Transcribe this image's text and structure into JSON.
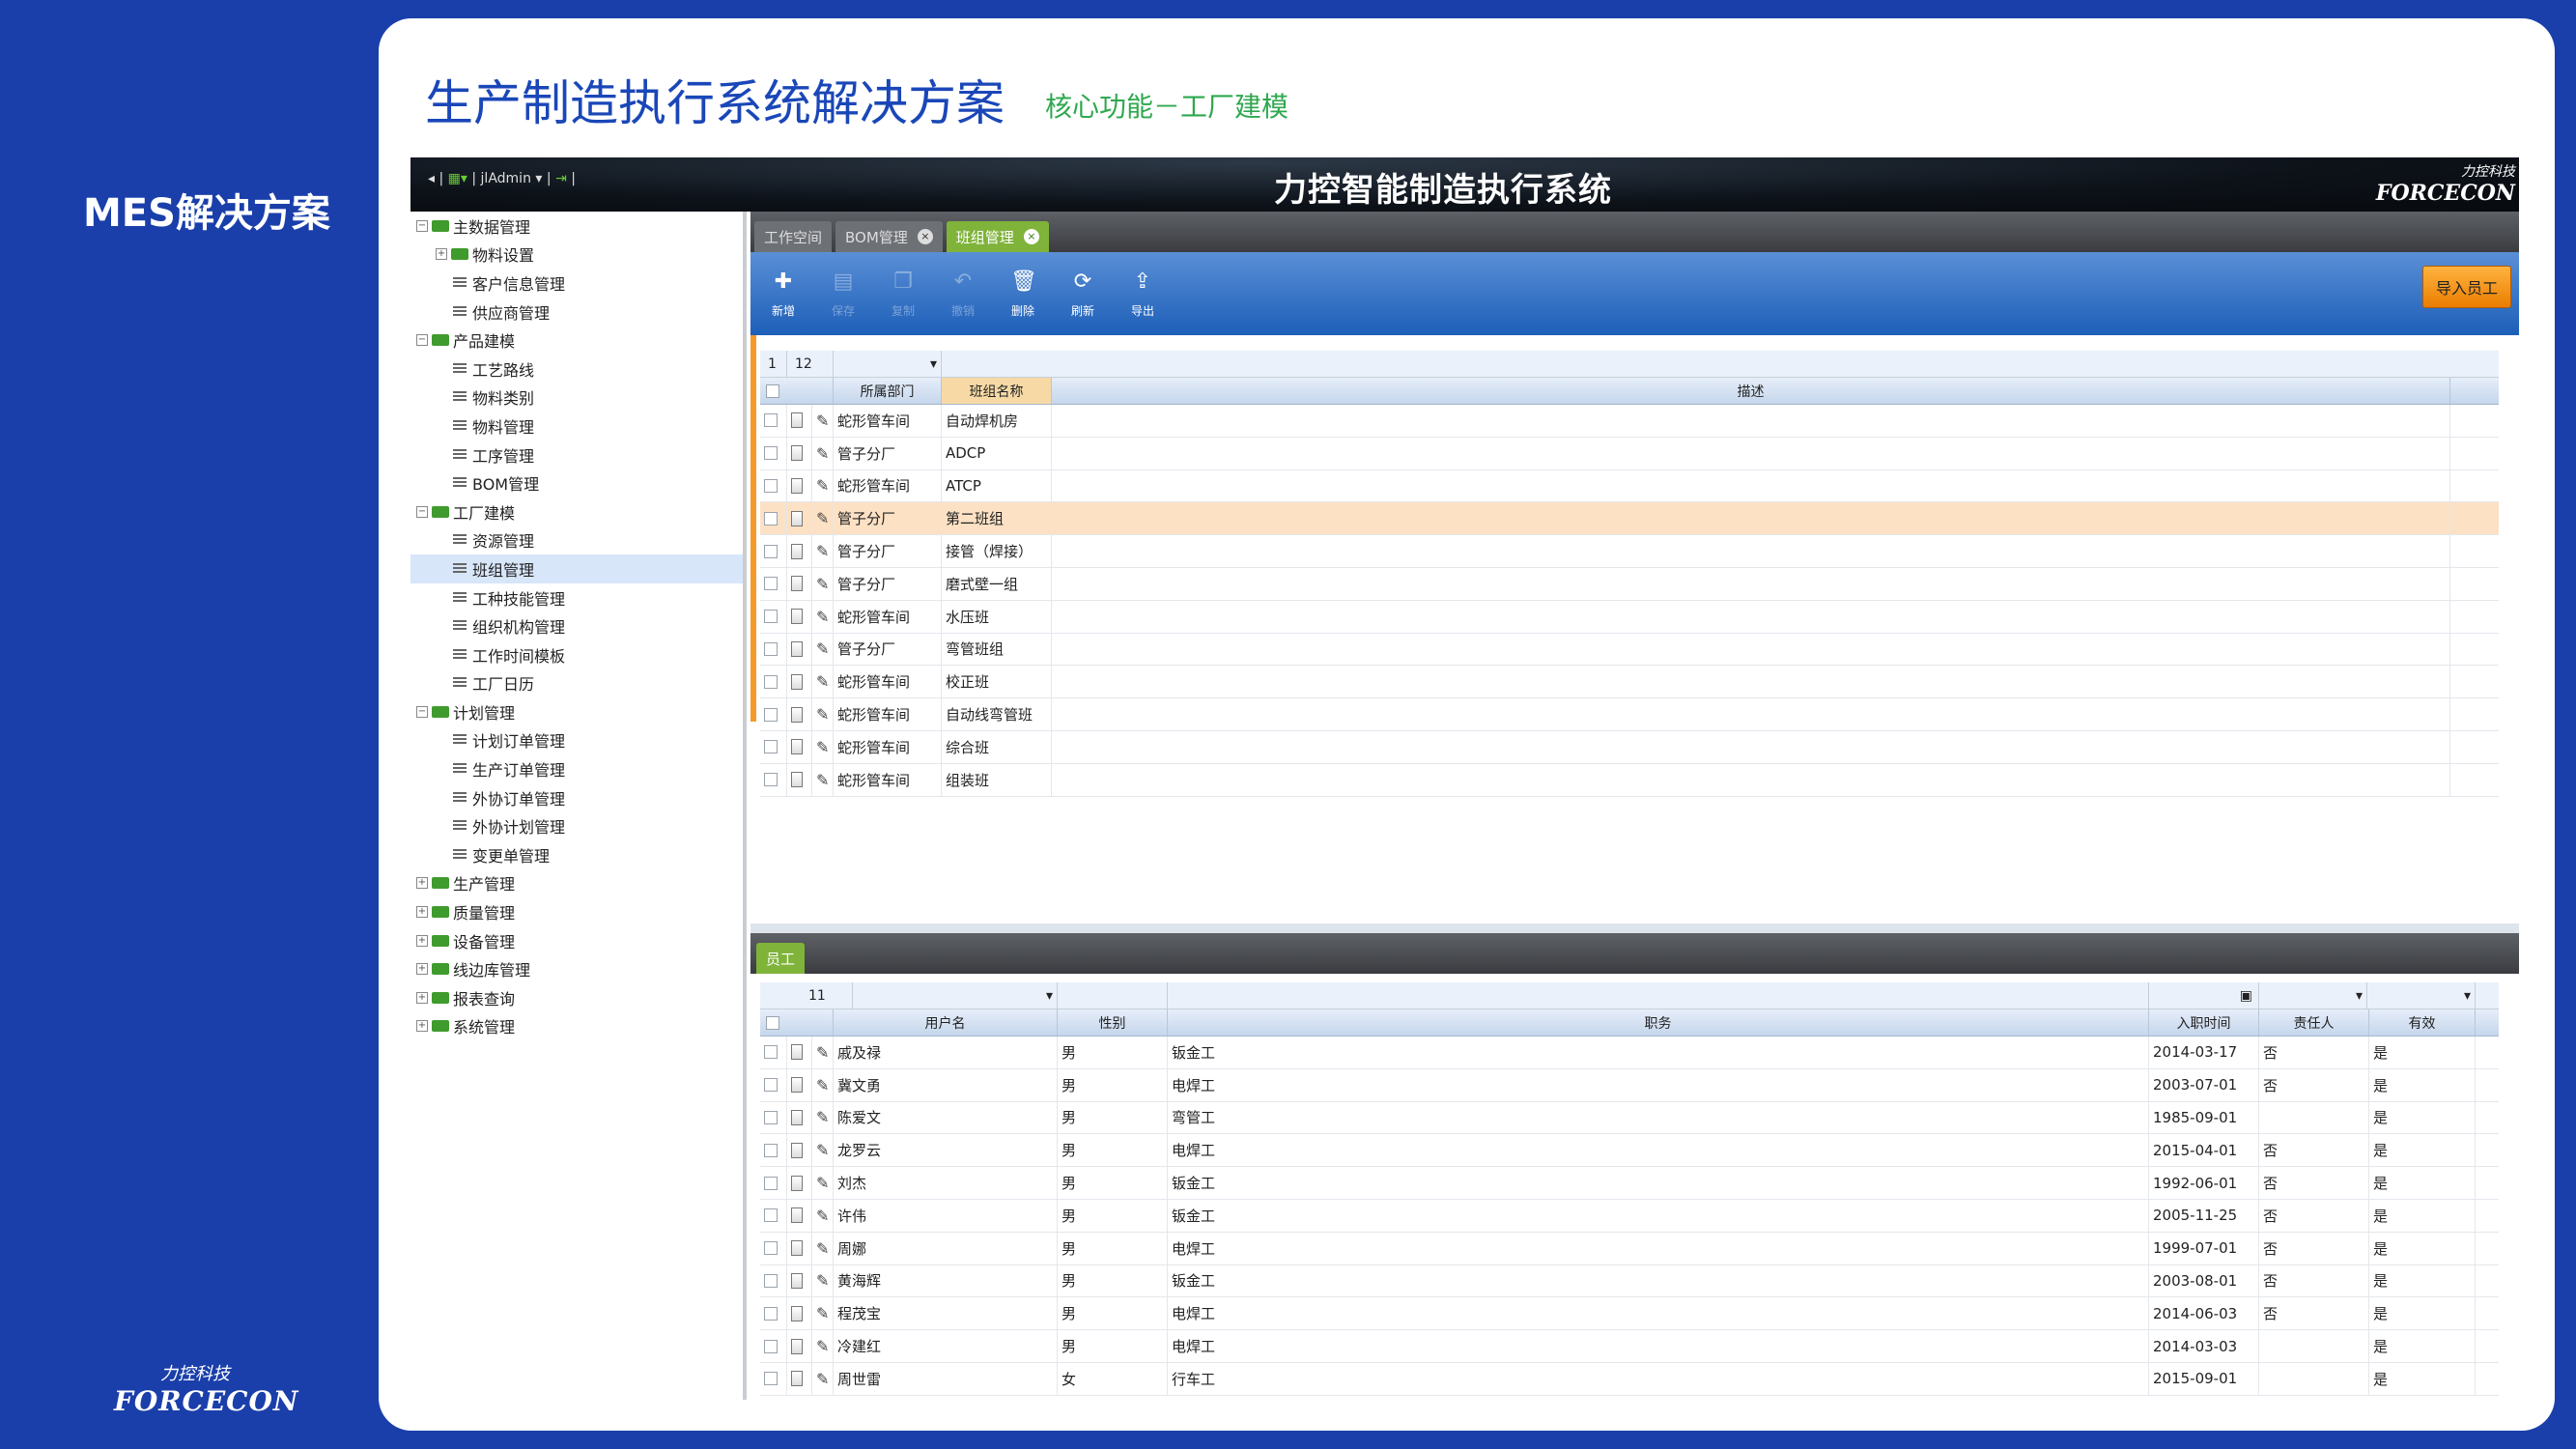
{
  "sidebar": {
    "title": "MES解决方案",
    "logo_cn": "力控科技",
    "logo_en": "FORCECON"
  },
  "slide": {
    "title": "生产制造执行系统解决方案",
    "subtitle": "核心功能－工厂建模"
  },
  "app": {
    "title": "力控智能制造执行系统",
    "brand_cn": "力控科技",
    "brand_en": "FORCECON",
    "user": "jlAdmin",
    "tabs": [
      "工作空间",
      "BOM管理",
      "班组管理"
    ],
    "active_tab": "班组管理",
    "toolbar": [
      {
        "label": "新增",
        "icon": "add-icon",
        "enabled": true
      },
      {
        "label": "保存",
        "icon": "save-icon",
        "enabled": false
      },
      {
        "label": "复制",
        "icon": "copy-icon",
        "enabled": false
      },
      {
        "label": "撤销",
        "icon": "undo-icon",
        "enabled": false
      },
      {
        "label": "删除",
        "icon": "trash-icon",
        "enabled": true
      },
      {
        "label": "刷新",
        "icon": "refresh-icon",
        "enabled": true
      },
      {
        "label": "导出",
        "icon": "export-icon",
        "enabled": true
      }
    ],
    "import_button": "导入员工"
  },
  "tree": [
    {
      "label": "主数据管理",
      "level": 0,
      "toggle": "−",
      "folder": true
    },
    {
      "label": "物料设置",
      "level": 1,
      "toggle": "+",
      "folder": true
    },
    {
      "label": "客户信息管理",
      "level": 2
    },
    {
      "label": "供应商管理",
      "level": 2
    },
    {
      "label": "产品建模",
      "level": 0,
      "toggle": "−",
      "folder": true
    },
    {
      "label": "工艺路线",
      "level": 2
    },
    {
      "label": "物料类别",
      "level": 2
    },
    {
      "label": "物料管理",
      "level": 2
    },
    {
      "label": "工序管理",
      "level": 2
    },
    {
      "label": "BOM管理",
      "level": 2
    },
    {
      "label": "工厂建模",
      "level": 0,
      "toggle": "−",
      "folder": true
    },
    {
      "label": "资源管理",
      "level": 2
    },
    {
      "label": "班组管理",
      "level": 2,
      "selected": true
    },
    {
      "label": "工种技能管理",
      "level": 2
    },
    {
      "label": "组织机构管理",
      "level": 2
    },
    {
      "label": "工作时间模板",
      "level": 2
    },
    {
      "label": "工厂日历",
      "level": 2
    },
    {
      "label": "计划管理",
      "level": 0,
      "toggle": "−",
      "folder": true
    },
    {
      "label": "计划订单管理",
      "level": 2
    },
    {
      "label": "生产订单管理",
      "level": 2
    },
    {
      "label": "外协订单管理",
      "level": 2
    },
    {
      "label": "外协计划管理",
      "level": 2
    },
    {
      "label": "变更单管理",
      "level": 2
    },
    {
      "label": "生产管理",
      "level": 0,
      "toggle": "+",
      "folder": true
    },
    {
      "label": "质量管理",
      "level": 0,
      "toggle": "+",
      "folder": true
    },
    {
      "label": "设备管理",
      "level": 0,
      "toggle": "+",
      "folder": true
    },
    {
      "label": "线边库管理",
      "level": 0,
      "toggle": "+",
      "folder": true
    },
    {
      "label": "报表查询",
      "level": 0,
      "toggle": "+",
      "folder": true
    },
    {
      "label": "系统管理",
      "level": 0,
      "toggle": "+",
      "folder": true
    }
  ],
  "team_grid": {
    "page": "1",
    "count": "12",
    "columns": [
      "所属部门",
      "班组名称",
      "描述"
    ],
    "rows": [
      [
        "蛇形管车间",
        "自动焊机房",
        ""
      ],
      [
        "管子分厂",
        "ADCP",
        ""
      ],
      [
        "蛇形管车间",
        "ATCP",
        ""
      ],
      [
        "管子分厂",
        "第二班组",
        ""
      ],
      [
        "管子分厂",
        "接管（焊接）",
        ""
      ],
      [
        "管子分厂",
        "磨式壁一组",
        ""
      ],
      [
        "蛇形管车间",
        "水压班",
        ""
      ],
      [
        "管子分厂",
        "弯管班组",
        ""
      ],
      [
        "蛇形管车间",
        "校正班",
        ""
      ],
      [
        "蛇形管车间",
        "自动线弯管班",
        ""
      ],
      [
        "蛇形管车间",
        "综合班",
        ""
      ],
      [
        "蛇形管车间",
        "组装班",
        ""
      ]
    ],
    "selected_row": 3
  },
  "employee_panel": {
    "tab": "员工"
  },
  "employee_grid": {
    "count": "11",
    "columns": [
      "用户名",
      "性别",
      "职务",
      "入职时间",
      "责任人",
      "有效"
    ],
    "rows": [
      [
        "戚及禄",
        "男",
        "钣金工",
        "2014-03-17",
        "否",
        "是"
      ],
      [
        "冀文勇",
        "男",
        "电焊工",
        "2003-07-01",
        "否",
        "是"
      ],
      [
        "陈爱文",
        "男",
        "弯管工",
        "1985-09-01",
        "",
        "是"
      ],
      [
        "龙罗云",
        "男",
        "电焊工",
        "2015-04-01",
        "否",
        "是"
      ],
      [
        "刘杰",
        "男",
        "钣金工",
        "1992-06-01",
        "否",
        "是"
      ],
      [
        "许伟",
        "男",
        "钣金工",
        "2005-11-25",
        "否",
        "是"
      ],
      [
        "周娜",
        "男",
        "电焊工",
        "1999-07-01",
        "否",
        "是"
      ],
      [
        "黄海辉",
        "男",
        "钣金工",
        "2003-08-01",
        "否",
        "是"
      ],
      [
        "程茂宝",
        "男",
        "电焊工",
        "2014-06-03",
        "否",
        "是"
      ],
      [
        "冷建红",
        "男",
        "电焊工",
        "2014-03-03",
        "",
        "是"
      ],
      [
        "周世雷",
        "女",
        "行车工",
        "2015-09-01",
        "",
        "是"
      ]
    ]
  }
}
